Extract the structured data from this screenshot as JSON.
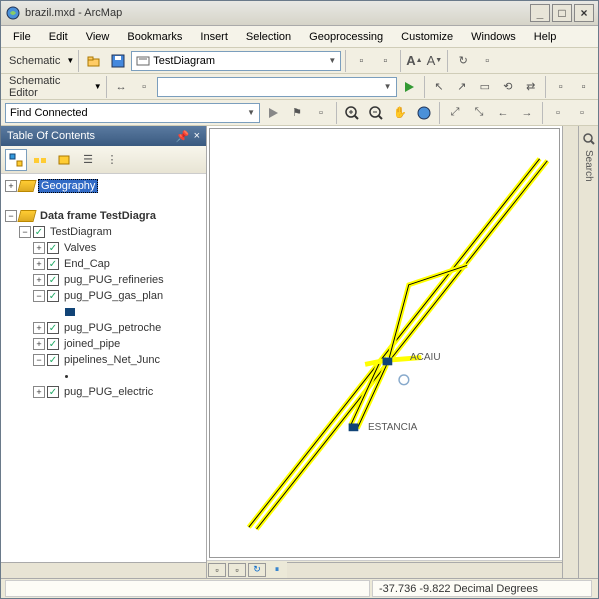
{
  "window": {
    "title": "brazil.mxd - ArcMap"
  },
  "menu": {
    "items": [
      "File",
      "Edit",
      "View",
      "Bookmarks",
      "Insert",
      "Selection",
      "Geoprocessing",
      "Customize",
      "Windows",
      "Help"
    ]
  },
  "toolbar1": {
    "schematic_label": "Schematic",
    "diagram_value": "TestDiagram"
  },
  "toolbar2": {
    "editor_label": "Schematic Editor"
  },
  "toolbar3": {
    "find_value": "Find Connected"
  },
  "toc": {
    "title": "Table Of Contents",
    "tree": {
      "geography": "Geography",
      "dataframe": "Data frame TestDiagra",
      "testdiagram": "TestDiagram",
      "layers": [
        "Valves",
        "End_Cap",
        "pug_PUG_refineries",
        "pug_PUG_gas_plan",
        "pug_PUG_petroche",
        "joined_pipe",
        "pipelines_Net_Junc",
        "pug_PUG_electric"
      ]
    }
  },
  "map": {
    "label1": "ACAIU",
    "label2": "ESTANCIA"
  },
  "right_panel": {
    "label": "Search"
  },
  "statusbar": {
    "coords": "-37.736   -9.822 Decimal Degrees"
  }
}
